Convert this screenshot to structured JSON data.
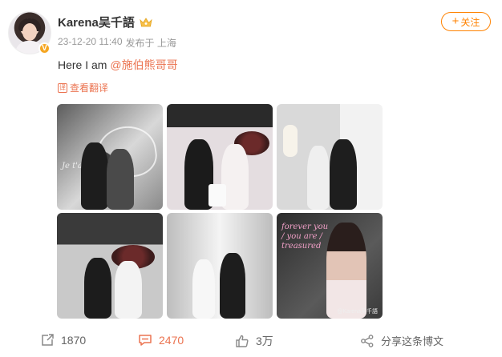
{
  "user": {
    "name": "Karena吴千語",
    "verified_badge": "V",
    "post_time": "23-12-20 11:40",
    "location": "发布于 上海"
  },
  "follow": {
    "plus": "+",
    "label": "关注"
  },
  "post": {
    "text": "Here I am ",
    "mention": "@施伯熊哥哥",
    "translate_label": "查看翻译",
    "translate_icon": "译"
  },
  "photos": [
    {
      "neon": "Je t'aime"
    },
    {
      "neon": ""
    },
    {
      "neon": ""
    },
    {
      "neon": ""
    },
    {
      "neon": ""
    },
    {
      "neon": "forever you / you are / treasured",
      "watermark": "@Karena吴千語"
    }
  ],
  "actions": {
    "repost_count": "1870",
    "comment_count": "2470",
    "like_count": "3万",
    "share_label": "分享这条博文"
  },
  "colors": {
    "accent": "#ff8200",
    "link": "#eb7350",
    "muted": "#999999"
  }
}
